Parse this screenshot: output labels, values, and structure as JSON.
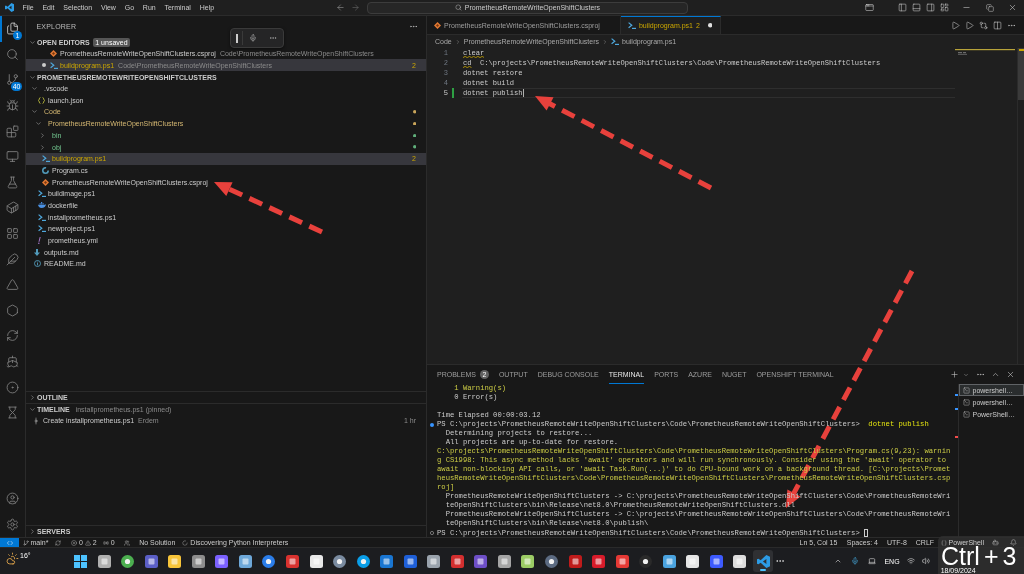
{
  "title_bar": {
    "menu": [
      "File",
      "Edit",
      "Selection",
      "View",
      "Go",
      "Run",
      "Terminal",
      "Help"
    ],
    "command_center": "PrometheusRemoteWriteOpenShiftClusters"
  },
  "activity_bar": {
    "items": [
      {
        "kind": "explorer",
        "badge": "1",
        "selected": true
      },
      {
        "kind": "search",
        "selected": false
      },
      {
        "kind": "source_control",
        "badge": "40",
        "selected": false
      },
      {
        "kind": "run_debug",
        "selected": false
      },
      {
        "kind": "extensions",
        "selected": false
      },
      {
        "kind": "remote_explorer",
        "selected": false
      },
      {
        "kind": "testing",
        "selected": false
      },
      {
        "kind": "docker",
        "selected": false
      },
      {
        "kind": "grid",
        "selected": false
      },
      {
        "kind": "feather",
        "selected": false
      },
      {
        "kind": "azure",
        "selected": false
      },
      {
        "kind": "hexagon",
        "selected": false
      },
      {
        "kind": "sync",
        "selected": false
      },
      {
        "kind": "ship",
        "selected": false
      },
      {
        "kind": "ring",
        "selected": false
      },
      {
        "kind": "hourglass",
        "selected": false
      }
    ],
    "bottom_items": [
      {
        "kind": "account"
      },
      {
        "kind": "settings"
      }
    ]
  },
  "sidebar": {
    "title": "EXPLORER",
    "open_editors": {
      "title": "OPEN EDITORS",
      "badge": "1 unsaved",
      "expanded": true,
      "items": [
        {
          "name": "PrometheusRemoteWriteOpenShiftClusters.csproj",
          "kind": "msbuild",
          "description": "Code\\PrometheusRemoteWriteOpenShiftClusters",
          "dirty": false,
          "warning": false,
          "selected": false
        },
        {
          "name": "buildprogram.ps1",
          "kind": "powershell",
          "description": "Code\\PrometheusRemoteWriteOpenShiftClusters",
          "dirty": true,
          "warning": true,
          "badge": "2",
          "selected": true
        }
      ]
    },
    "folder": {
      "title": "PROMETHEUSREMOTEWRITEOPENSHIFTCLUSTERS",
      "expanded": true,
      "children": [
        {
          "name": ".vscode",
          "kind": "folder",
          "expanded": true,
          "modified": false,
          "untracked": false,
          "warning": false,
          "selected": false,
          "children": [
            {
              "name": "launch.json",
              "kind": "json",
              "modified": false,
              "untracked": false,
              "warning": false,
              "selected": false
            }
          ]
        },
        {
          "name": "Code",
          "kind": "folder",
          "expanded": true,
          "modified": true,
          "untracked": false,
          "warning": false,
          "selected": false,
          "children": [
            {
              "name": "PrometheusRemoteWriteOpenShiftClusters",
              "kind": "folder",
              "expanded": true,
              "modified": true,
              "untracked": false,
              "warning": false,
              "selected": false,
              "children": [
                {
                  "name": "bin",
                  "kind": "folder",
                  "expanded": false,
                  "modified": false,
                  "untracked": true,
                  "warning": false,
                  "selected": false
                },
                {
                  "name": "obj",
                  "kind": "folder",
                  "expanded": false,
                  "modified": false,
                  "untracked": true,
                  "warning": false,
                  "selected": false
                },
                {
                  "name": "buildprogram.ps1",
                  "kind": "powershell",
                  "modified": false,
                  "untracked": false,
                  "warning": true,
                  "badge": "2",
                  "selected": true
                },
                {
                  "name": "Program.cs",
                  "kind": "csharp",
                  "modified": false,
                  "untracked": false,
                  "warning": false,
                  "selected": false
                },
                {
                  "name": "PrometheusRemoteWriteOpenShiftClusters.csproj",
                  "kind": "msbuild",
                  "modified": false,
                  "untracked": false,
                  "warning": false,
                  "selected": false
                }
              ]
            },
            {
              "name": "buildimage.ps1",
              "kind": "powershell",
              "modified": false,
              "untracked": false,
              "warning": false,
              "selected": false
            },
            {
              "name": "dockerfile",
              "kind": "docker",
              "modified": false,
              "untracked": false,
              "warning": false,
              "selected": false
            },
            {
              "name": "installprometheus.ps1",
              "kind": "powershell",
              "modified": false,
              "untracked": false,
              "warning": false,
              "selected": false
            },
            {
              "name": "newproject.ps1",
              "kind": "powershell",
              "modified": false,
              "untracked": false,
              "warning": false,
              "selected": false
            },
            {
              "name": "prometheus.yml",
              "kind": "yaml",
              "modified": false,
              "untracked": false,
              "warning": false,
              "selected": false
            }
          ]
        },
        {
          "name": "outputs.md",
          "kind": "markdown",
          "modified": false,
          "untracked": false,
          "warning": false,
          "selected": false
        },
        {
          "name": "README.md",
          "kind": "info",
          "modified": false,
          "untracked": false,
          "warning": false,
          "selected": false
        }
      ]
    },
    "outline": {
      "title": "OUTLINE",
      "expanded": false
    },
    "timeline": {
      "title": "TIMELINE",
      "description": "installprometheus.ps1 (pinned)",
      "expanded": true,
      "items": [
        {
          "label": "Create installprometheus.ps1",
          "author": "Erdem",
          "time": "1 hr"
        }
      ]
    },
    "servers": {
      "title": "SERVERS",
      "expanded": false
    }
  },
  "editor": {
    "tabs": [
      {
        "label": "PrometheusRemoteWriteOpenShiftClusters.csproj",
        "kind": "msbuild",
        "warning": false,
        "dirty": false,
        "selected": false
      },
      {
        "label": "buildprogram.ps1",
        "kind": "powershell",
        "warning": true,
        "problems": "2",
        "dirty": true,
        "selected": true
      }
    ],
    "breadcrumbs": [
      {
        "label": "Code",
        "kind": "folder"
      },
      {
        "label": "PrometheusRemoteWriteOpenShiftClusters",
        "kind": "folder"
      },
      {
        "label": "buildprogram.ps1",
        "kind": "powershell"
      }
    ],
    "lines": [
      {
        "number": "1",
        "current": false,
        "added": false,
        "segments": [
          {
            "text": "clear",
            "squiggle": true
          }
        ]
      },
      {
        "number": "2",
        "current": false,
        "added": false,
        "segments": [
          {
            "text": "cd",
            "squiggle": true
          },
          {
            "text": "  C:\\projects\\PrometheusRemoteWriteOpenShiftClusters\\Code\\PrometheusRemoteWriteOpenShiftClusters",
            "squiggle": false
          }
        ]
      },
      {
        "number": "3",
        "current": false,
        "added": false,
        "segments": [
          {
            "text": "dotnet restore",
            "squiggle": false
          }
        ]
      },
      {
        "number": "4",
        "current": false,
        "added": false,
        "segments": [
          {
            "text": "dotnet build",
            "squiggle": false
          }
        ]
      },
      {
        "number": "5",
        "current": true,
        "added": true,
        "segments": [
          {
            "text": "dotnet publish",
            "squiggle": false
          }
        ]
      }
    ]
  },
  "panel": {
    "tabs": [
      {
        "label": "PROBLEMS",
        "badge": "2",
        "selected": false
      },
      {
        "label": "OUTPUT",
        "selected": false
      },
      {
        "label": "DEBUG CONSOLE",
        "selected": false
      },
      {
        "label": "TERMINAL",
        "selected": true
      },
      {
        "label": "PORTS",
        "selected": false
      },
      {
        "label": "AZURE",
        "selected": false
      },
      {
        "label": "NUGET",
        "selected": false
      },
      {
        "label": "OPENSHIFT TERMINAL",
        "selected": false
      }
    ],
    "terminal": {
      "lines": [
        {
          "kind": "output",
          "segments": [
            {
              "text": "    1 Warning(s)",
              "kind": "warning"
            }
          ]
        },
        {
          "kind": "output",
          "segments": [
            {
              "text": "    0 Error(s)",
              "kind": "plain"
            }
          ]
        },
        {
          "kind": "blank"
        },
        {
          "kind": "output",
          "segments": [
            {
              "text": "Time Elapsed 00:00:03.12",
              "kind": "plain"
            }
          ]
        },
        {
          "kind": "command",
          "segments": [
            {
              "text": "PS C:\\projects\\PrometheusRemoteWriteOpenShiftClusters\\Code\\PrometheusRemoteWriteOpenShiftClusters>  ",
              "kind": "plain"
            },
            {
              "text": "dotnet publish",
              "kind": "command"
            }
          ]
        },
        {
          "kind": "output",
          "segments": [
            {
              "text": "  Determining projects to restore...",
              "kind": "plain"
            }
          ]
        },
        {
          "kind": "output",
          "segments": [
            {
              "text": "  All projects are up-to-date for restore.",
              "kind": "plain"
            }
          ]
        },
        {
          "kind": "output",
          "segments": [
            {
              "text": "C:\\projects\\PrometheusRemoteWriteOpenShiftClusters\\Code\\PrometheusRemoteWriteOpenShiftClusters\\Program.cs(9,23): warnin",
              "kind": "warning"
            }
          ]
        },
        {
          "kind": "output",
          "segments": [
            {
              "text": "g CS1998: This async method lacks 'await' operators and will run synchronously. Consider using the 'await' operator to",
              "kind": "warning"
            }
          ]
        },
        {
          "kind": "output",
          "segments": [
            {
              "text": "await non-blocking API calls, or 'await Task.Run(...)' to do CPU-bound work on a background thread. [C:\\projects\\Promet",
              "kind": "warning"
            }
          ]
        },
        {
          "kind": "output",
          "segments": [
            {
              "text": "heusRemoteWriteOpenShiftClusters\\Code\\PrometheusRemoteWriteOpenShiftClusters\\PrometheusRemoteWriteOpenShiftClusters.csp",
              "kind": "warning"
            }
          ]
        },
        {
          "kind": "output",
          "segments": [
            {
              "text": "roj]",
              "kind": "warning"
            }
          ]
        },
        {
          "kind": "output",
          "segments": [
            {
              "text": "  PrometheusRemoteWriteOpenShiftClusters -> C:\\projects\\PrometheusRemoteWriteOpenShiftClusters\\Code\\PrometheusRemoteWri",
              "kind": "plain"
            }
          ]
        },
        {
          "kind": "output",
          "segments": [
            {
              "text": "  teOpenShiftClusters\\bin\\Release\\net8.0\\PrometheusRemoteWriteOpenShiftClusters.dll",
              "kind": "plain"
            }
          ]
        },
        {
          "kind": "output",
          "segments": [
            {
              "text": "  PrometheusRemoteWriteOpenShiftClusters -> C:\\projects\\PrometheusRemoteWriteOpenShiftClusters\\Code\\PrometheusRemoteWri",
              "kind": "plain"
            }
          ]
        },
        {
          "kind": "output",
          "segments": [
            {
              "text": "  teOpenShiftClusters\\bin\\Release\\net8.0\\publish\\",
              "kind": "plain"
            }
          ]
        }
      ],
      "prompt": {
        "text": "PS C:\\projects\\PrometheusRemoteWriteOpenShiftClusters\\Code\\PrometheusRemoteWriteOpenShiftClusters> ",
        "cursor": true
      }
    },
    "terminals": [
      {
        "label": "powershell…",
        "selected": true
      },
      {
        "label": "powershell…",
        "selected": false
      },
      {
        "label": "PowerShell…",
        "selected": false
      }
    ]
  },
  "status_bar": {
    "branch": "main*",
    "errors": "0",
    "warnings": "2",
    "ports": "0",
    "solution": "No Solution",
    "progress": "Discovering Python Interpreters",
    "cursor_position": "Ln 5, Col 15",
    "indentation": "Spaces: 4",
    "encoding": "UTF-8",
    "line_ending": "CRLF",
    "language": "PowerShell"
  },
  "taskbar": {
    "weather": "16°",
    "apps": [
      {
        "selected": false
      },
      {
        "selected": false
      },
      {
        "selected": false
      },
      {
        "selected": false
      },
      {
        "selected": false
      },
      {
        "selected": false
      },
      {
        "selected": false
      },
      {
        "selected": false
      },
      {
        "selected": false
      },
      {
        "selected": false
      },
      {
        "selected": false
      },
      {
        "selected": false
      },
      {
        "selected": false
      },
      {
        "selected": false
      },
      {
        "selected": false
      },
      {
        "selected": false
      },
      {
        "selected": false
      },
      {
        "selected": false
      },
      {
        "selected": false
      },
      {
        "selected": false
      },
      {
        "selected": false
      },
      {
        "selected": false
      },
      {
        "selected": false
      },
      {
        "selected": false
      },
      {
        "selected": false
      },
      {
        "selected": false
      },
      {
        "selected": false
      },
      {
        "selected": false
      },
      {
        "selected": false
      },
      {
        "selected": true
      }
    ],
    "language": "ENG",
    "date": "18/09/2024"
  },
  "key_overlay": {
    "keys": [
      "Ctrl",
      "+",
      "3"
    ]
  }
}
